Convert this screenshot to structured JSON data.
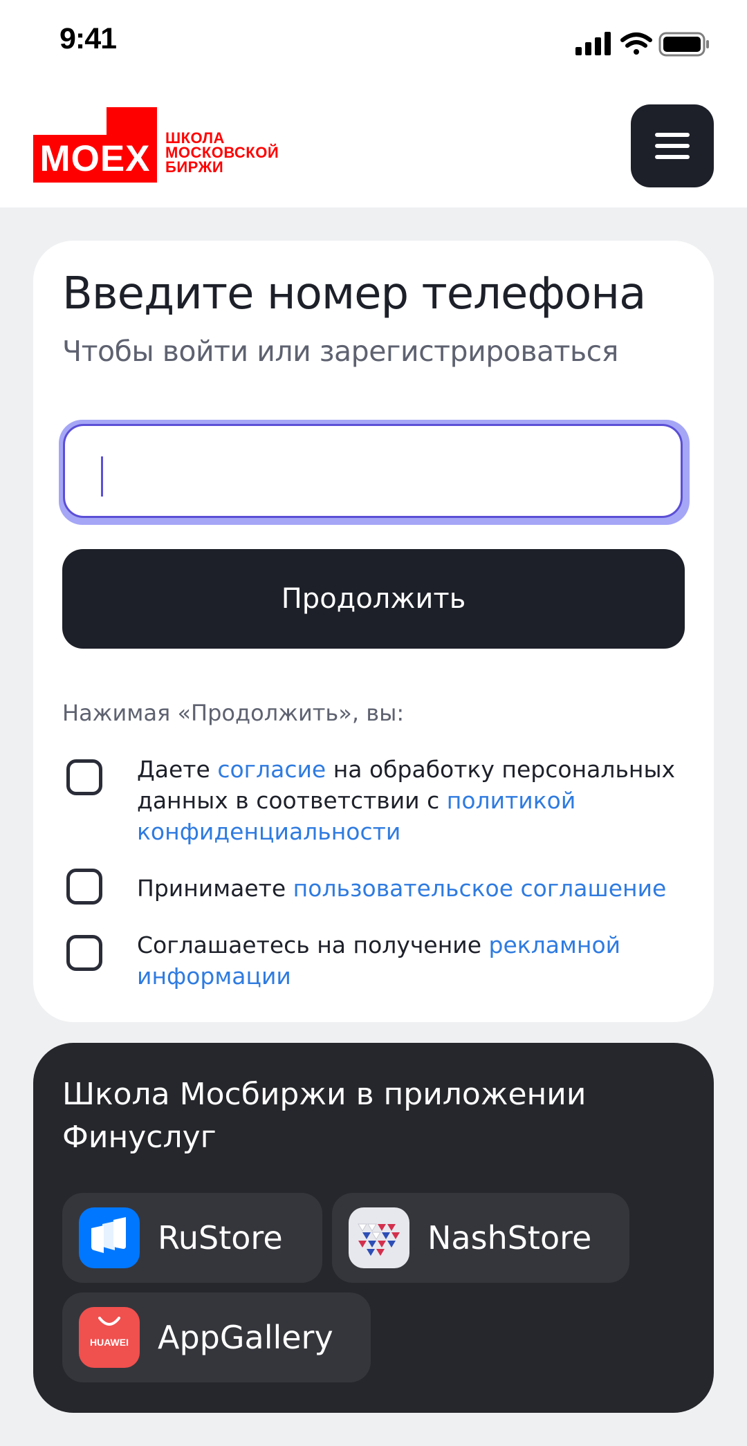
{
  "status_bar": {
    "time": "9:41"
  },
  "header": {
    "logo": {
      "brand": "MOEX",
      "line1": "ШКОЛА",
      "line2": "МОСКОВСКОЙ",
      "line3": "БИРЖИ"
    },
    "menu_icon": "hamburger-menu-icon"
  },
  "login": {
    "title": "Введите номер телефона",
    "subtitle": "Чтобы войти или зарегистрироваться",
    "phone_input": {
      "value": "",
      "placeholder": ""
    },
    "continue_label": "Продолжить",
    "consent_intro": "Нажимая «Продолжить», вы:",
    "consents": [
      {
        "text_before": "Даете ",
        "link1": "согласие",
        "text_middle": " на обработку персональных данных в соответствии с ",
        "link2": "политикой конфиденциальности",
        "checked": false
      },
      {
        "text_before": "Принимаете ",
        "link1": "пользовательское соглашение",
        "checked": false
      },
      {
        "text_before": "Соглашаетесь на получение ",
        "link1": "рекламной информации",
        "checked": false
      }
    ]
  },
  "apps": {
    "title": "Школа Мосбиржи в приложении Финуслуг",
    "stores": [
      {
        "label": "RuStore",
        "icon": "rustore-icon"
      },
      {
        "label": "NashStore",
        "icon": "nashstore-icon"
      },
      {
        "label": "AppGallery",
        "icon": "appgallery-icon",
        "icon_text": "HUAWEI"
      }
    ]
  },
  "colors": {
    "brand_red": "#FF0000",
    "dark": "#1D2029",
    "link_blue": "#2F7BE0",
    "focus_purple": "#5B4FD6",
    "background": "#EFF0F2"
  }
}
